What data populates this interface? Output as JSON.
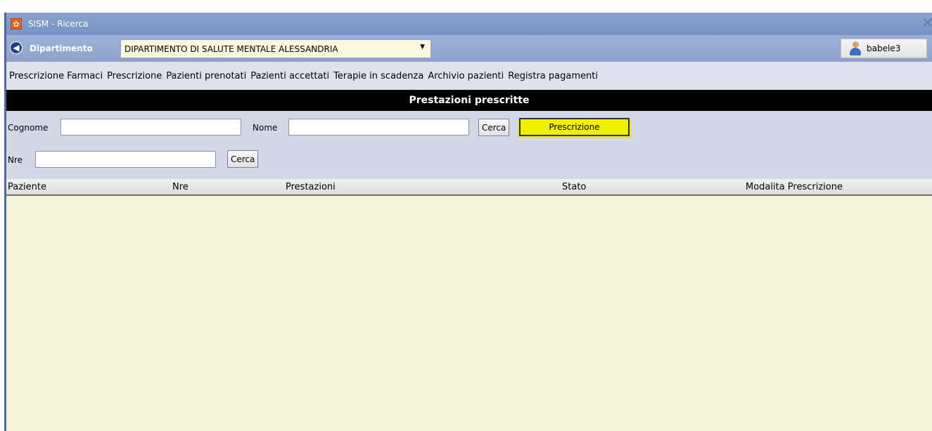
{
  "window": {
    "title": "SISM - Ricerca",
    "close_glyph": "✕",
    "app_icon": "sism-app-icon"
  },
  "dept_bar": {
    "back_icon": "back-arrow-icon",
    "label": "Dipartimento",
    "selected": "DIPARTIMENTO DI SALUTE MENTALE ALESSANDRIA",
    "arrow_glyph": "▼",
    "user": "babele3",
    "user_icon": "user-icon"
  },
  "menu": {
    "items": [
      "Prescrizione Farmaci",
      "Prescrizione",
      "Pazienti prenotati",
      "Pazienti accettati",
      "Terapie in scadenza",
      "Archivio pazienti",
      "Registra pagamenti"
    ]
  },
  "section": {
    "title": "Prestazioni prescritte"
  },
  "form": {
    "cognome_label": "Cognome",
    "cognome_value": "",
    "nome_label": "Nome",
    "nome_value": "",
    "cerca_label": "Cerca",
    "prescrizione_label": "Prescrizione",
    "nre_label": "Nre",
    "nre_value": "",
    "cerca2_label": "Cerca"
  },
  "grid": {
    "columns": [
      "Paziente",
      "Nre",
      "Prestazioni",
      "Stato",
      "Modalita Prescrizione"
    ],
    "rows": []
  },
  "colors": {
    "title_bar": "#7893c3",
    "section_header": "#000000",
    "highlight_button": "#f2ef00",
    "grid_background": "#f4f3da"
  }
}
